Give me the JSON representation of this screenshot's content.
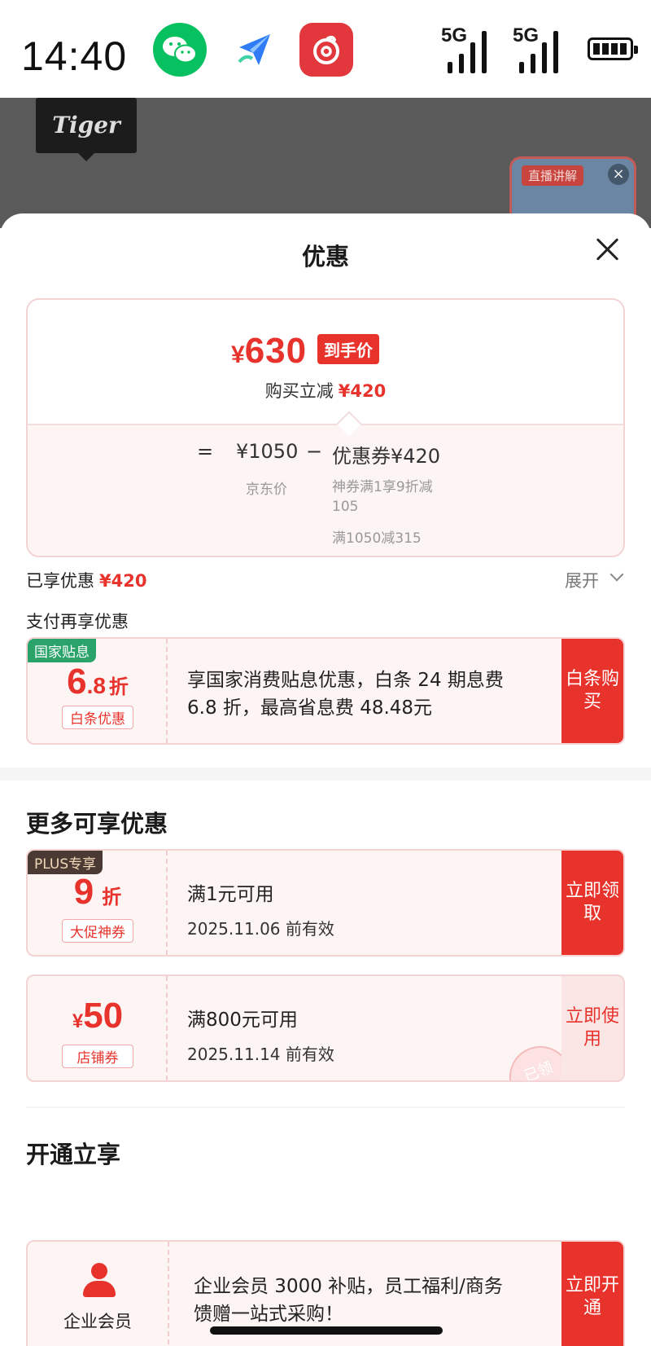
{
  "status_bar": {
    "time": "14:40",
    "signal1": "5G",
    "signal2": "5G"
  },
  "background": {
    "brand_logo_text": "Tiger",
    "live_badge": "直播讲解",
    "live_close": "×"
  },
  "sheet": {
    "title": "优惠",
    "price_card": {
      "currency": "¥",
      "final_price": "630",
      "final_tag": "到手价",
      "instant_label": "购买立减",
      "instant_amount": "¥420",
      "eq": "=",
      "base_price": "¥1050",
      "minus": "−",
      "coupon_total": "优惠券¥420",
      "base_note": "京东价",
      "coupon_note1": "神券满1享9折减105",
      "coupon_note2": "满1050减315"
    },
    "enjoyed": {
      "label": "已享优惠",
      "amount": "¥420",
      "expand": "展开"
    },
    "pay_more_label": "支付再享优惠",
    "baitiao": {
      "corner": "国家贴息",
      "big_int": "6",
      "big_dec": ".8",
      "unit": "折",
      "tag": "白条优惠",
      "text": "享国家消费贴息优惠，白条 24 期息费 6.8 折，最高省息费 48.48元",
      "action": "白条购买"
    },
    "more_title": "更多可享优惠",
    "coupons": [
      {
        "corner": "PLUS专享",
        "big": "9",
        "unit": "折",
        "tag": "大促神券",
        "cond": "满1元可用",
        "valid": "2025.11.06 前有效",
        "action": "立即领取"
      },
      {
        "currency": "¥",
        "big": "50",
        "tag": "店铺券",
        "cond": "满800元可用",
        "valid": "2025.11.14 前有效",
        "action": "立即使用",
        "stamp": "已领"
      }
    ],
    "open_title": "开通立享",
    "vip": {
      "name": "企业会员",
      "text": "企业会员 3000 补贴，员工福利/商务馈赠一站式采购！",
      "action": "立即开通"
    }
  }
}
